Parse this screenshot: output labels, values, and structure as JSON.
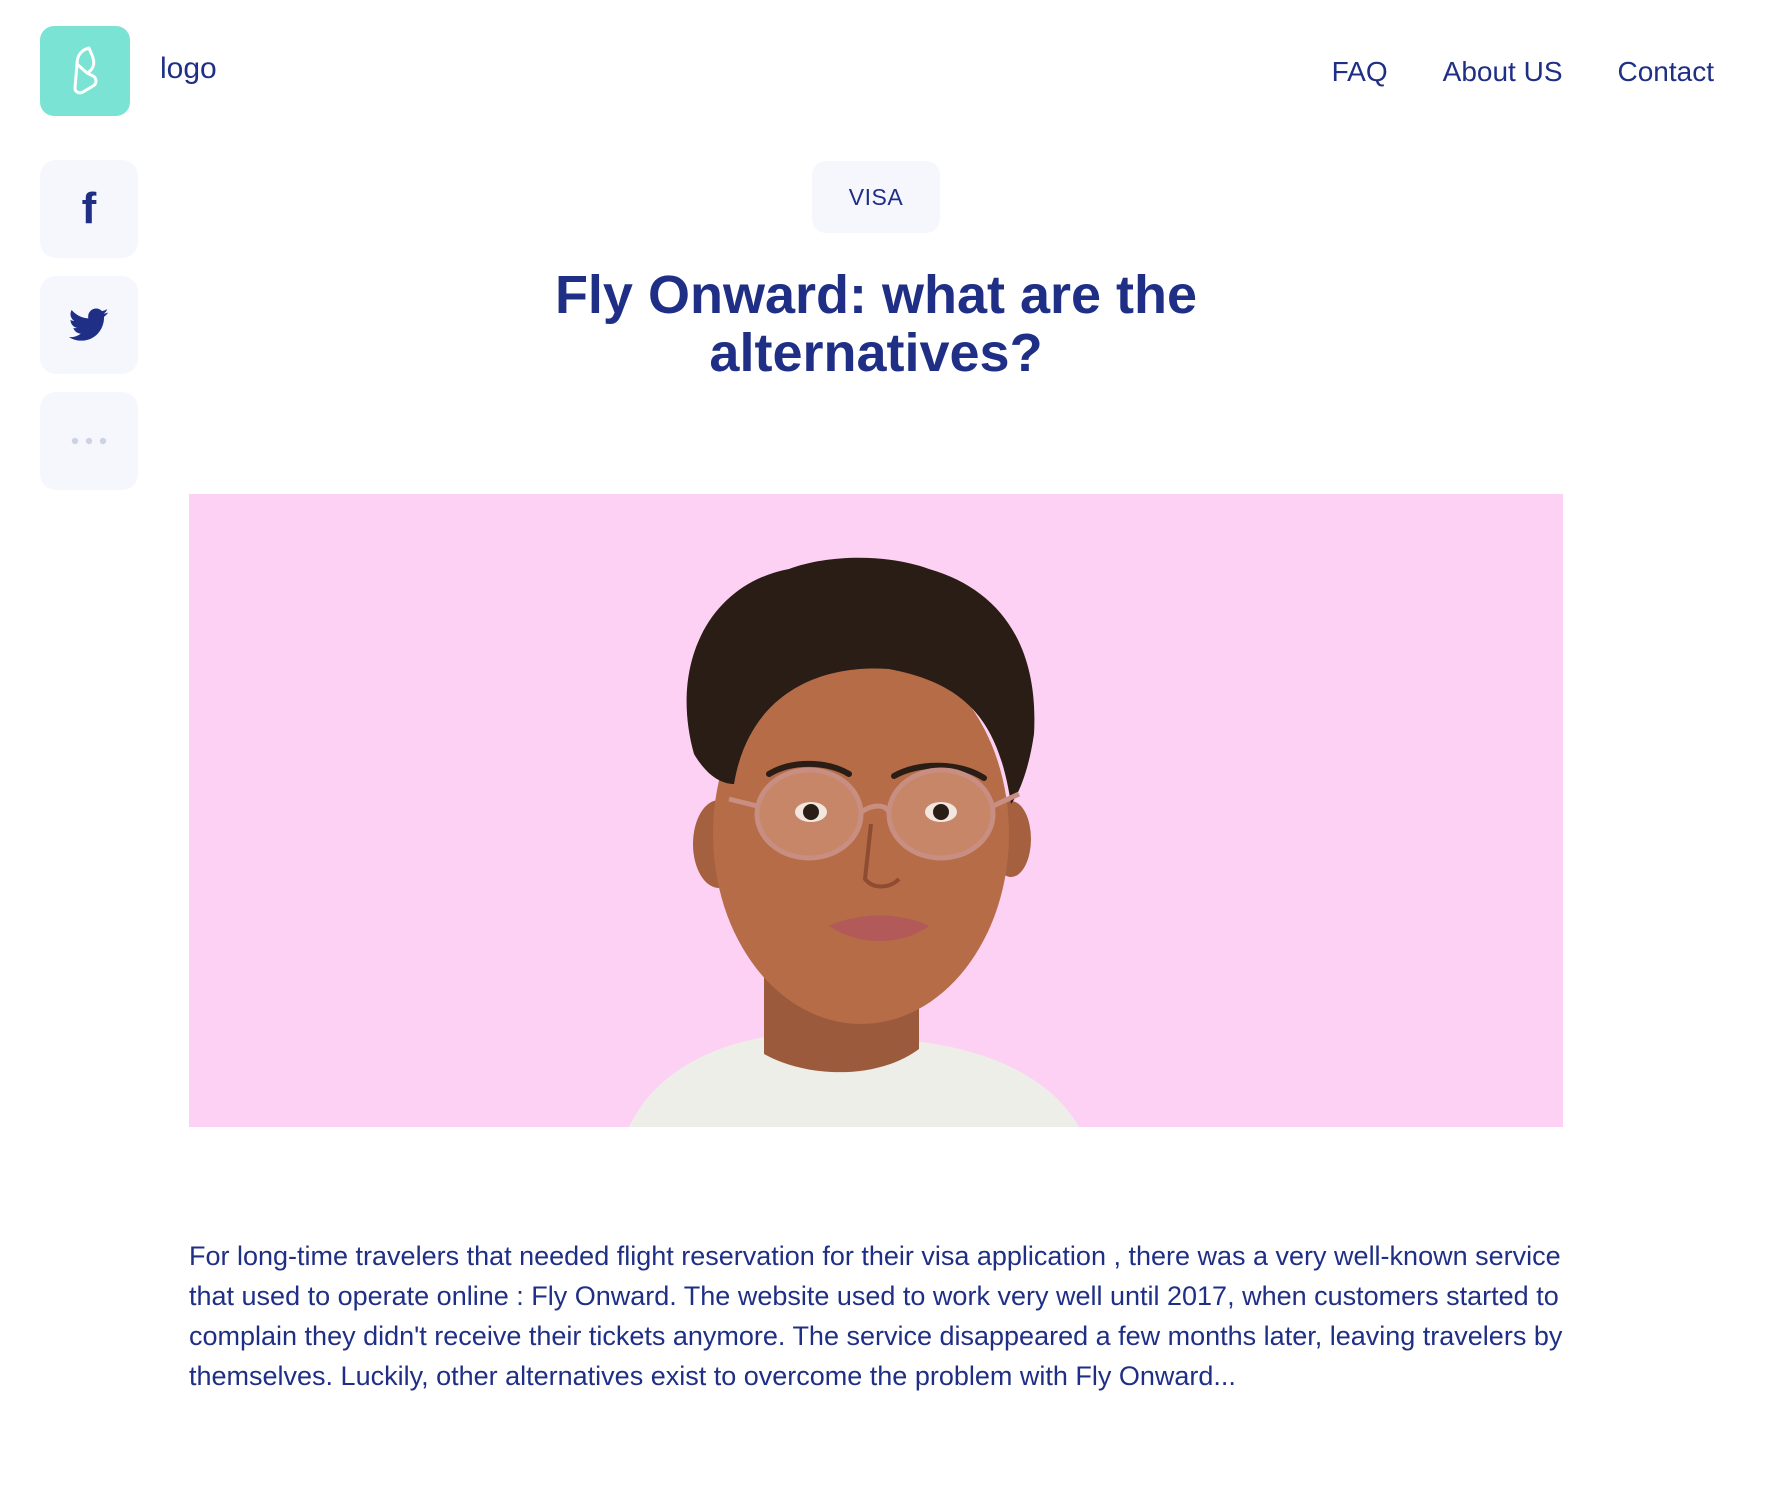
{
  "header": {
    "logo_text": "logo",
    "nav": [
      {
        "label": "FAQ"
      },
      {
        "label": "About US"
      },
      {
        "label": "Contact"
      }
    ]
  },
  "social": [
    {
      "icon": "facebook-icon"
    },
    {
      "icon": "twitter-icon"
    },
    {
      "icon": "more-icon"
    }
  ],
  "article": {
    "category": "VISA",
    "title": "Fly Onward: what are the alternatives?",
    "excerpt": "For long-time travelers that needed flight reservation for their visa application , there was a very well-known service that used to operate online : Fly Onward. The website used to work very well until 2017, when customers started to complain they didn't receive their tickets anymore. The service disappeared a few months later, leaving travelers by themselves. Luckily, other alternatives exist to overcome the problem with Fly Onward..."
  },
  "colors": {
    "primary_text": "#1f2f86",
    "logo_tile": "#7ae3d4",
    "tile_bg": "#f5f7fd",
    "hero_bg": "#fdd1f3"
  }
}
